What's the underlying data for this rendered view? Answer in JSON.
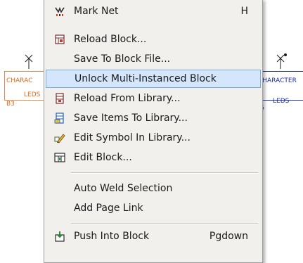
{
  "schematic": {
    "left_box_label": "CHARAC",
    "left_sub_label": "LEDS",
    "left_ref": "B3",
    "right_box_label": "CHARACTER",
    "right_sub_label": "LEDS",
    "right_ref": "6"
  },
  "menu": {
    "items": [
      {
        "label": "Mark Net",
        "shortcut": "H",
        "icon": "mark-net-icon"
      },
      {
        "label": "Reload Block...",
        "shortcut": "",
        "icon": "reload-block-icon"
      },
      {
        "label": "Save To Block File...",
        "shortcut": "",
        "icon": ""
      },
      {
        "label": "Unlock Multi-Instanced Block",
        "shortcut": "",
        "icon": "",
        "highlighted": true
      },
      {
        "label": "Reload From Library...",
        "shortcut": "",
        "icon": "reload-library-icon"
      },
      {
        "label": "Save Items To Library...",
        "shortcut": "",
        "icon": "save-library-icon"
      },
      {
        "label": "Edit Symbol In Library...",
        "shortcut": "",
        "icon": "edit-symbol-icon"
      },
      {
        "label": "Edit Block...",
        "shortcut": "",
        "icon": "edit-block-icon"
      },
      {
        "label": "Auto Weld Selection",
        "shortcut": "",
        "icon": ""
      },
      {
        "label": "Add Page Link",
        "shortcut": "",
        "icon": ""
      },
      {
        "label": "Push Into Block",
        "shortcut": "Pgdown",
        "icon": "push-into-block-icon"
      }
    ]
  }
}
